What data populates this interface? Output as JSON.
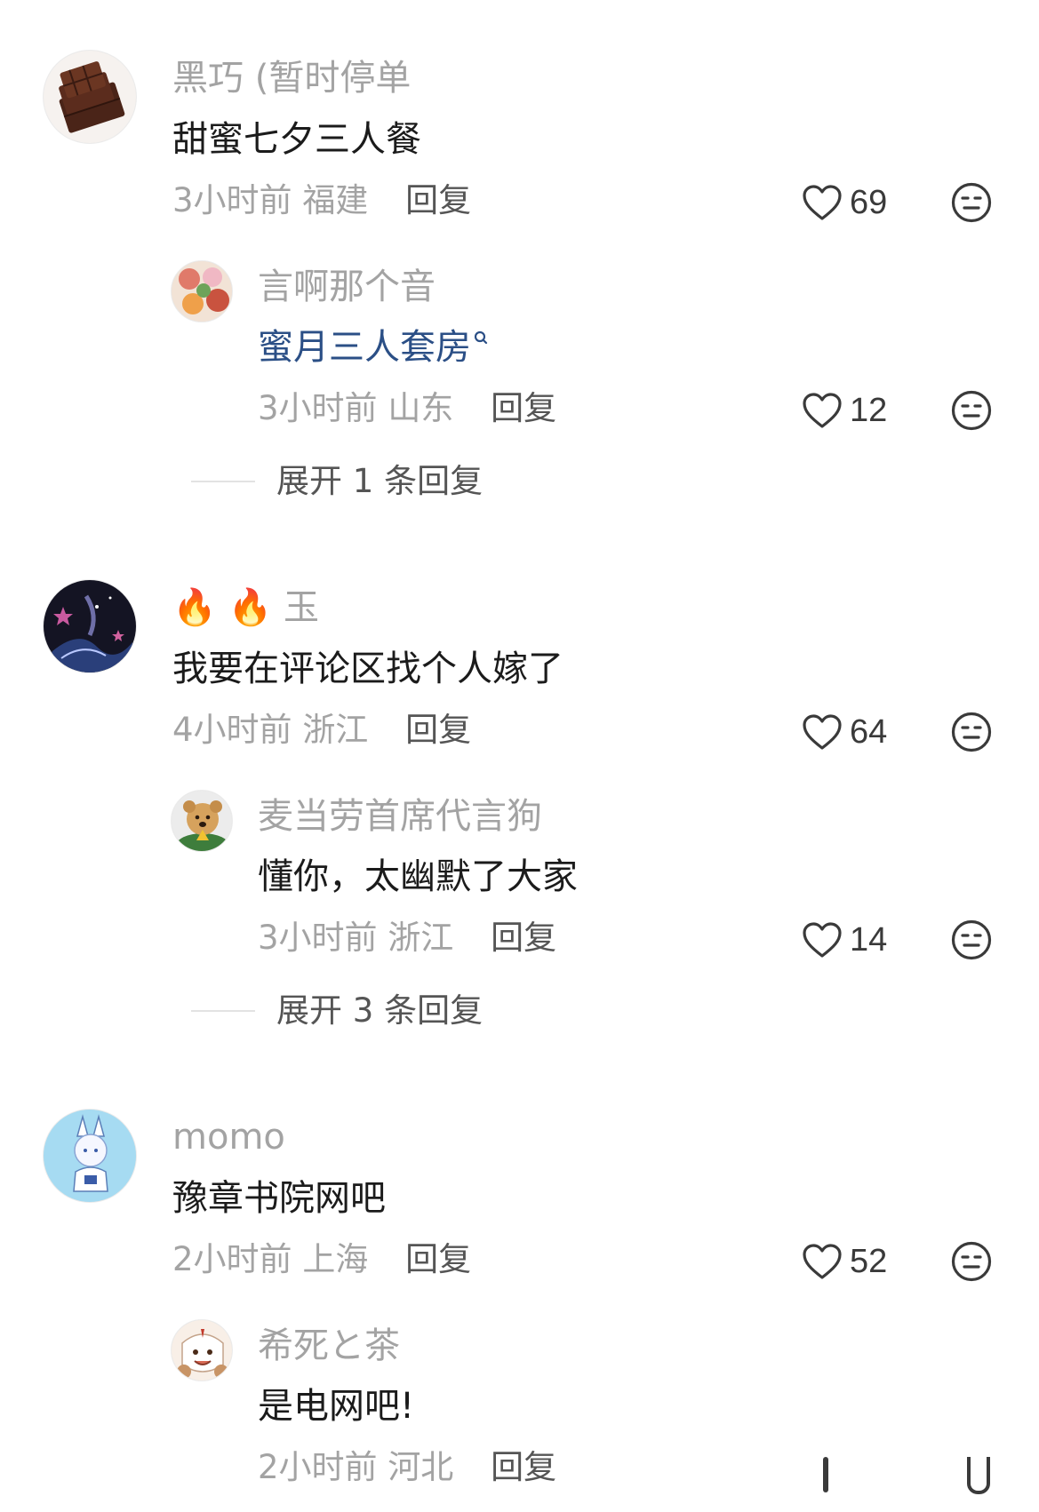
{
  "comments": [
    {
      "username": "黑巧 (暂时停单",
      "text": "甜蜜七夕三人餐",
      "time": "3小时前",
      "location": "福建",
      "reply_label": "回复",
      "likes": "69",
      "avatar": "chocolate-avatar",
      "replies": [
        {
          "username": "言啊那个音",
          "text": "蜜月三人套房",
          "time": "3小时前",
          "location": "山东",
          "reply_label": "回复",
          "likes": "12",
          "avatar": "food-avatar"
        }
      ],
      "expand_label": "展开 1 条回复"
    },
    {
      "username_emoji": "🔥 🔥",
      "username": "玉",
      "text": "我要在评论区找个人嫁了",
      "time": "4小时前",
      "location": "浙江",
      "reply_label": "回复",
      "likes": "64",
      "avatar": "galaxy-avatar",
      "replies": [
        {
          "username": "麦当劳首席代言狗",
          "text": "懂你，太幽默了大家",
          "time": "3小时前",
          "location": "浙江",
          "reply_label": "回复",
          "likes": "14",
          "avatar": "dog-avatar"
        }
      ],
      "expand_label": "展开 3 条回复"
    },
    {
      "username": "momo",
      "text": "豫章书院网吧",
      "time": "2小时前",
      "location": "上海",
      "reply_label": "回复",
      "likes": "52",
      "avatar": "anime-avatar",
      "replies": [
        {
          "username": "希死と茶",
          "text": "是电网吧!",
          "time": "2小时前",
          "location": "河北",
          "reply_label": "回复",
          "avatar": "cartoon-avatar"
        }
      ]
    }
  ],
  "colors": {
    "username": "#a3a3a3",
    "text": "#1b1b1b",
    "link": "#2b4f86",
    "meta": "#a3a3a3"
  }
}
